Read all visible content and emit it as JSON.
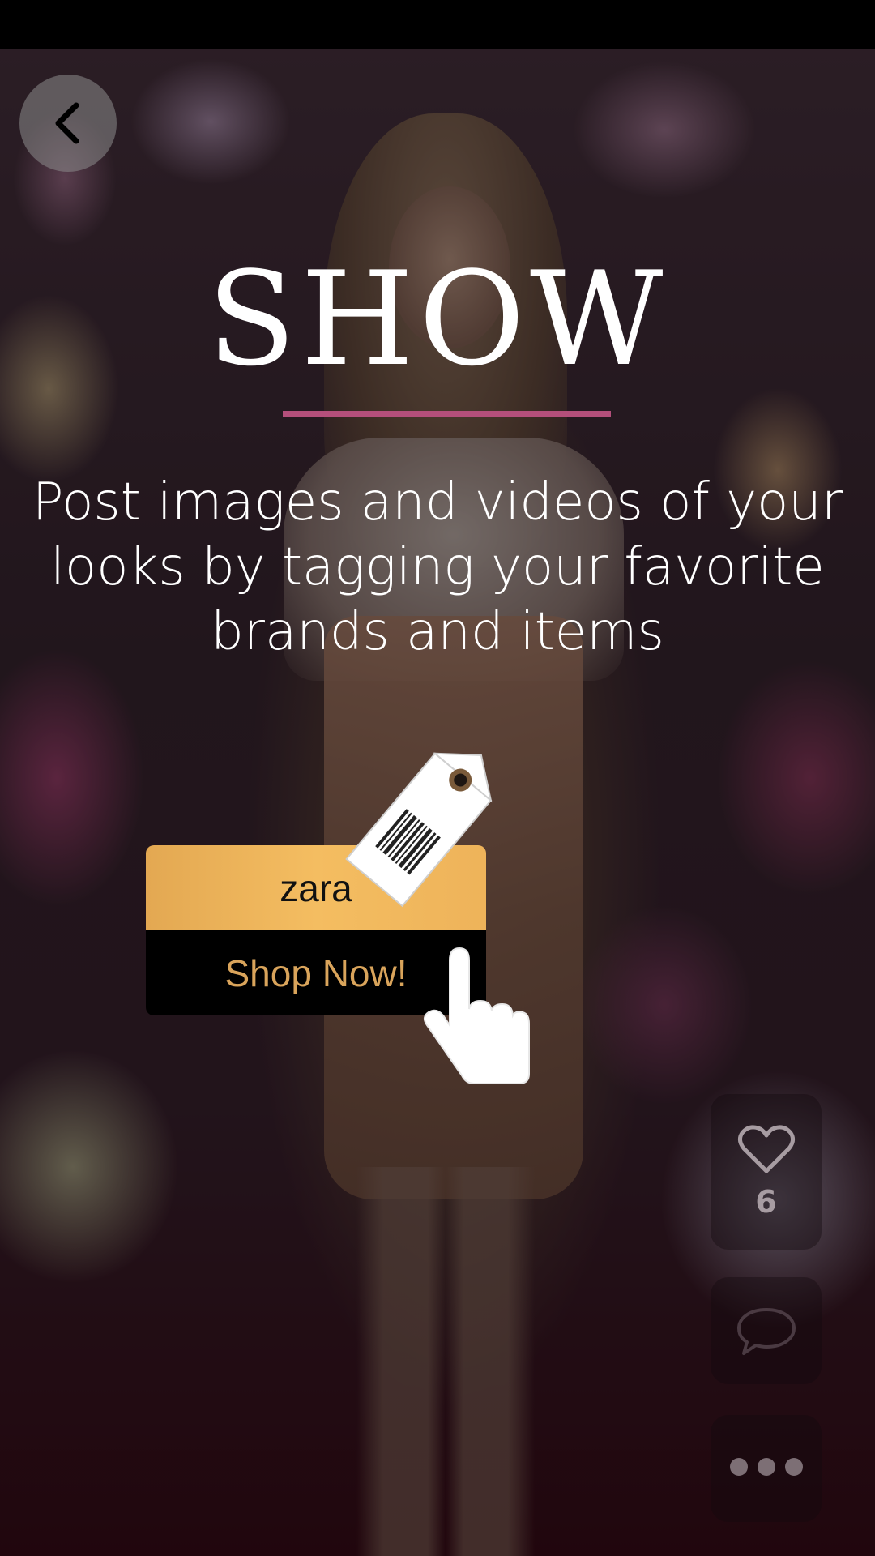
{
  "header": {
    "back_icon": "chevron-left-icon"
  },
  "onboarding": {
    "title": "SHOW",
    "subtitle": "Post images and videos of your looks by tagging your favorite brands and items",
    "accent_color": "#b44f7b"
  },
  "tag_card": {
    "brand": "zara",
    "action_label": "Shop Now!",
    "brand_color": "#f4bd61",
    "action_text_color": "#d9a45b"
  },
  "actions": {
    "like_icon": "heart-icon",
    "like_count": "6",
    "comment_icon": "speech-bubble-icon",
    "more_icon": "more-horizontal-icon"
  }
}
